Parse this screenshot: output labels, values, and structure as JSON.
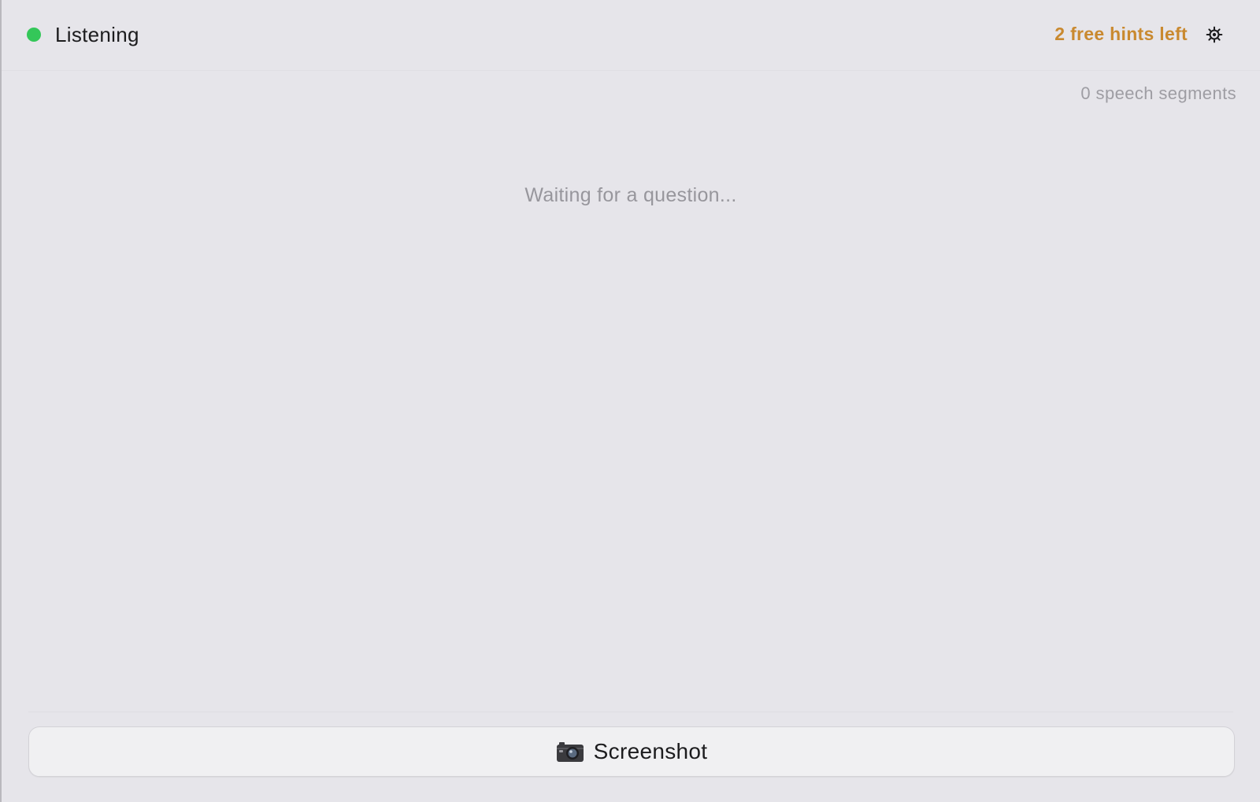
{
  "header": {
    "status_label": "Listening",
    "status_color": "#34c759",
    "hints_label": "2 free hints left",
    "hints_color": "#c9892f",
    "settings_icon": "gear-icon"
  },
  "transcript": {
    "segments_label": "0 speech segments",
    "placeholder": "Waiting for a question..."
  },
  "footer": {
    "screenshot_label": "Screenshot",
    "screenshot_icon": "camera-icon"
  }
}
